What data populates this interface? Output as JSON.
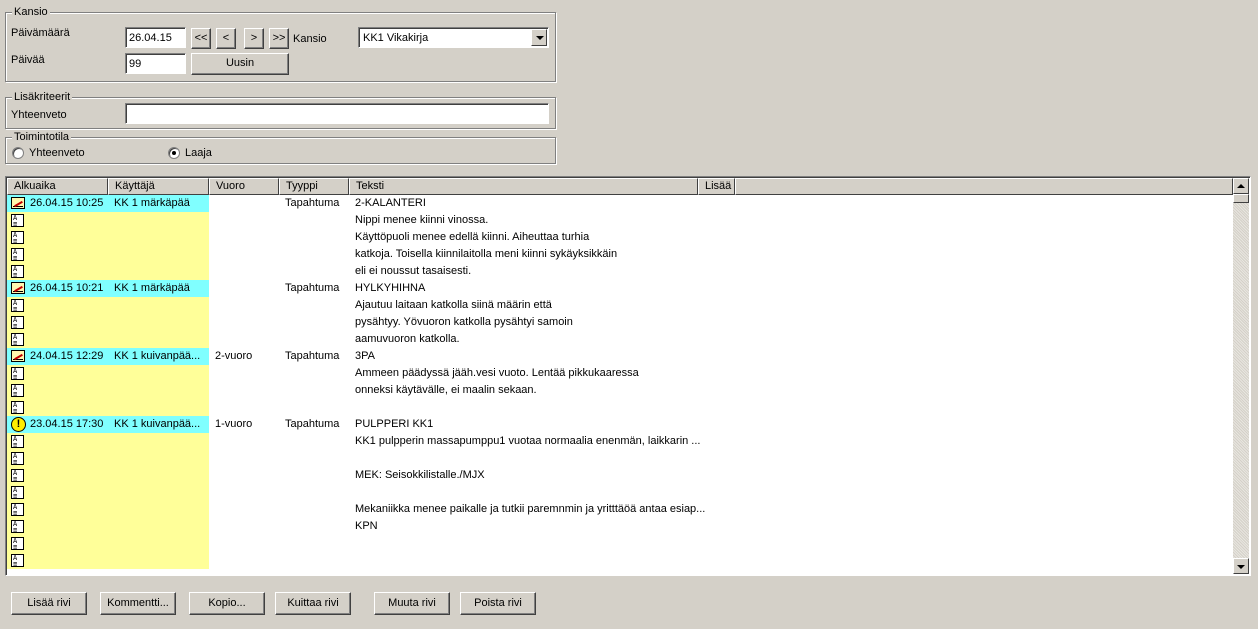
{
  "kansio_group": {
    "legend": "Kansio",
    "date_label": "Päivämäärä",
    "date_value": "26.04.15",
    "nav_first": "<<",
    "nav_prev": "<",
    "nav_next": ">",
    "nav_last": ">>",
    "folder_label": "Kansio",
    "folder_value": "KK1 Vikakirja",
    "days_label": "Päivää",
    "days_value": "99",
    "refresh_button": "Uusin"
  },
  "extra_group": {
    "legend": "Lisäkriteerit",
    "summary_label": "Yhteenveto",
    "summary_value": ""
  },
  "mode_group": {
    "legend": "Toimintotila",
    "option_summary": "Yhteenveto",
    "option_wide": "Laaja",
    "selected": "Laaja"
  },
  "grid": {
    "columns": [
      "Alkuaika",
      "Käyttäjä",
      "Vuoro",
      "Tyyppi",
      "Teksti",
      "Lisää"
    ],
    "rows": [
      {
        "icon": "edit-icon",
        "alkuaika": "26.04.15 10:25",
        "kayttaja": "KK 1 märkäpää",
        "vuoro": "",
        "tyyppi": "Tapahtuma",
        "teksti": "2-KALANTERI"
      },
      {
        "icon": "note-icon",
        "teksti": "Nippi menee kiinni vinossa."
      },
      {
        "icon": "note-icon",
        "teksti": "Käyttöpuoli menee edellä kiinni. Aiheuttaa turhia"
      },
      {
        "icon": "note-icon",
        "teksti": "katkoja. Toisella kiinnilaitolla meni kiinni sykäyksikkäin"
      },
      {
        "icon": "note-icon",
        "teksti": "eli ei noussut tasaisesti."
      },
      {
        "icon": "edit-icon",
        "alkuaika": "26.04.15 10:21",
        "kayttaja": "KK 1 märkäpää",
        "vuoro": "",
        "tyyppi": "Tapahtuma",
        "teksti": "HYLKYHIHNA"
      },
      {
        "icon": "note-icon",
        "teksti": "Ajautuu laitaan katkolla siinä määrin että"
      },
      {
        "icon": "note-icon",
        "teksti": "pysähtyy. Yövuoron katkolla pysähtyi samoin"
      },
      {
        "icon": "note-icon",
        "teksti": "aamuvuoron katkolla."
      },
      {
        "icon": "edit-icon",
        "alkuaika": "24.04.15 12:29",
        "kayttaja": "KK 1 kuivanpää...",
        "vuoro": "2-vuoro",
        "tyyppi": "Tapahtuma",
        "teksti": "3PA"
      },
      {
        "icon": "note-icon",
        "teksti": "Ammeen päädyssä jääh.vesi vuoto. Lentää pikkukaaressa"
      },
      {
        "icon": "note-icon",
        "teksti": "onneksi käytävälle, ei maalin sekaan."
      },
      {
        "icon": "note-icon",
        "teksti": ""
      },
      {
        "icon": "warning-icon",
        "alkuaika": "23.04.15 17:30",
        "kayttaja": "KK 1 kuivanpää...",
        "vuoro": "1-vuoro",
        "tyyppi": "Tapahtuma",
        "teksti": "PULPPERI KK1"
      },
      {
        "icon": "note-icon",
        "teksti": "KK1 pulpperin massapumppu1 vuotaa  normaalia enenmän, laikkarin ..."
      },
      {
        "icon": "note-icon",
        "teksti": ""
      },
      {
        "icon": "note-icon",
        "teksti": "MEK: Seisokkilistalle./MJX"
      },
      {
        "icon": "note-icon",
        "teksti": ""
      },
      {
        "icon": "note-icon",
        "teksti": "Mekaniikka menee paikalle ja tutkii paremnmin ja yritttäöä antaa esiap..."
      },
      {
        "icon": "note-icon",
        "teksti": "KPN"
      },
      {
        "icon": "note-icon",
        "teksti": ""
      },
      {
        "icon": "note-icon",
        "teksti": ""
      }
    ]
  },
  "actions": {
    "add_row": "Lisää rivi",
    "comment": "Kommentti...",
    "copy": "Kopio...",
    "acknowledge": "Kuittaa rivi",
    "modify": "Muuta rivi",
    "delete": "Poista rivi"
  },
  "colors": {
    "header_row_bg": "#80ffff",
    "user_column_bg": "#ffff99",
    "window_bg": "#d4d0c8"
  }
}
